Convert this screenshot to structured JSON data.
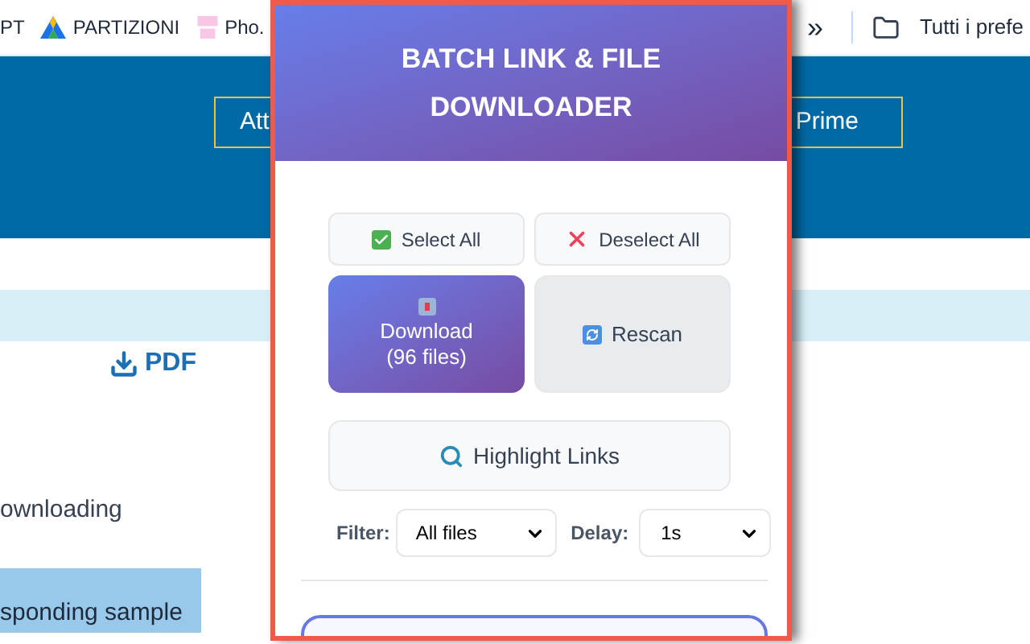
{
  "bookmarks": [
    {
      "label": "PT",
      "kind": "text"
    },
    {
      "label": "PARTIZIONI",
      "kind": "logo"
    },
    {
      "label": "Pho.",
      "kind": "photo"
    }
  ],
  "bookmarks_more": "»",
  "bookmarks_folder": "Tutti i prefe",
  "page": {
    "header_buttons": [
      "Att",
      "Prime"
    ],
    "pdf_link": "PDF",
    "text_fragment": "ownloading",
    "highlight_fragment": "sponding sample"
  },
  "popup": {
    "title": "BATCH LINK & FILE DOWNLOADER",
    "buttons": [
      {
        "label": "Select All",
        "kind": "select"
      },
      {
        "label": "Deselect All",
        "kind": "deselect"
      }
    ],
    "download": {
      "label": "Download",
      "count": "(96 files)"
    },
    "rescan": "Rescan",
    "highlight": "Highlight Links",
    "filter": {
      "label": "Filter:",
      "value": "All files"
    },
    "delay": {
      "label": "Delay:",
      "value": "1s"
    }
  }
}
